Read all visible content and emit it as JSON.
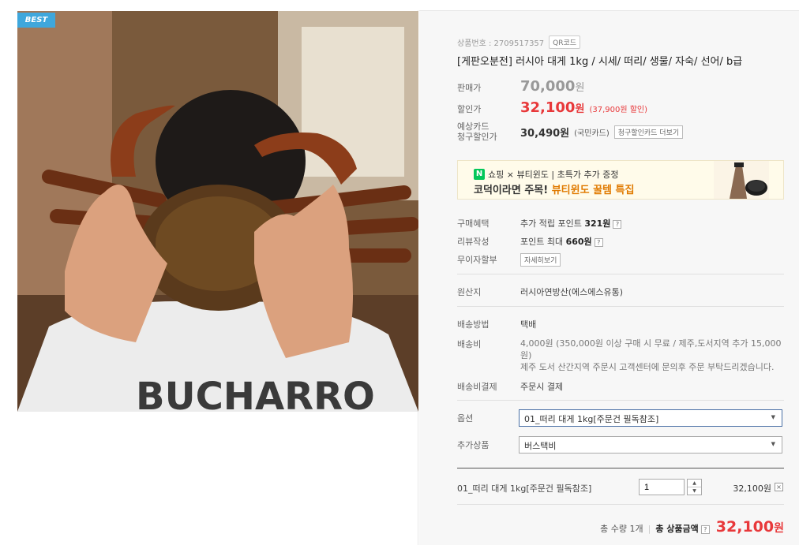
{
  "badge": "BEST",
  "product": {
    "number_label": "상품번호 : 2709517357",
    "qr_label": "QR코드",
    "title": "[게판오분전] 러시아 대게 1kg / 시세/ 떠리/ 생물/ 자숙/ 선어/ b급"
  },
  "price": {
    "orig_label": "판매가",
    "orig_value": "70,000",
    "won": "원",
    "sale_label": "할인가",
    "sale_value": "32,100",
    "discount_note": "(37,900원 할인)",
    "card_label_1": "예상카드",
    "card_label_2": "청구할인가",
    "card_value": "30,490원",
    "card_name": "(국민카드)",
    "card_more": "청구할인카드 더보기"
  },
  "banner": {
    "logo": "N",
    "line1": "쇼핑 × 뷰티윈도 | 초특가 추가 증정",
    "line2_a": "코덕이라면 주목! ",
    "line2_b": "뷰티윈도 꿀템 특집"
  },
  "benefits": {
    "buy_label": "구매혜택",
    "buy_text": "추가 적립 포인트 ",
    "buy_points": "321원",
    "review_label": "리뷰작성",
    "review_text": "포인트 최대 ",
    "review_points": "660원",
    "installment_label": "무이자할부",
    "installment_btn": "자세히보기"
  },
  "origin": {
    "label": "원산지",
    "value": "러시아연방산(에스에스유통)"
  },
  "shipping": {
    "method_label": "배송방법",
    "method_value": "택배",
    "fee_label": "배송비",
    "fee_line1": "4,000원 (350,000원 이상 구매 시 무료 / 제주,도서지역 추가 15,000",
    "fee_line2": "원)",
    "fee_line3": "제주 도서 산간지역 주문시 고객센터에 문의후 주문 부탁드리겠습니다.",
    "pay_label": "배송비결제",
    "pay_value": "주문시 결제"
  },
  "options": {
    "option_label": "옵션",
    "option_value": "01_떠리 대게 1kg[주문건 필독참조]",
    "addon_label": "추가상품",
    "addon_value": "버스택비"
  },
  "selected": {
    "name": "01_떠리 대게 1kg[주문건 필독참조]",
    "qty": "1",
    "price": "32,100원",
    "remove": "×"
  },
  "total": {
    "qty_text": "총 수량 1개",
    "label": "총 상품금액",
    "help": "?",
    "value": "32,100",
    "won": "원"
  },
  "icons": {
    "arrow": "▼",
    "up": "▲",
    "down": "▼",
    "help": "?"
  },
  "colors": {
    "accent_red": "#e8383a",
    "badge_blue": "#3fa7dc",
    "naver_green": "#03c75a"
  }
}
